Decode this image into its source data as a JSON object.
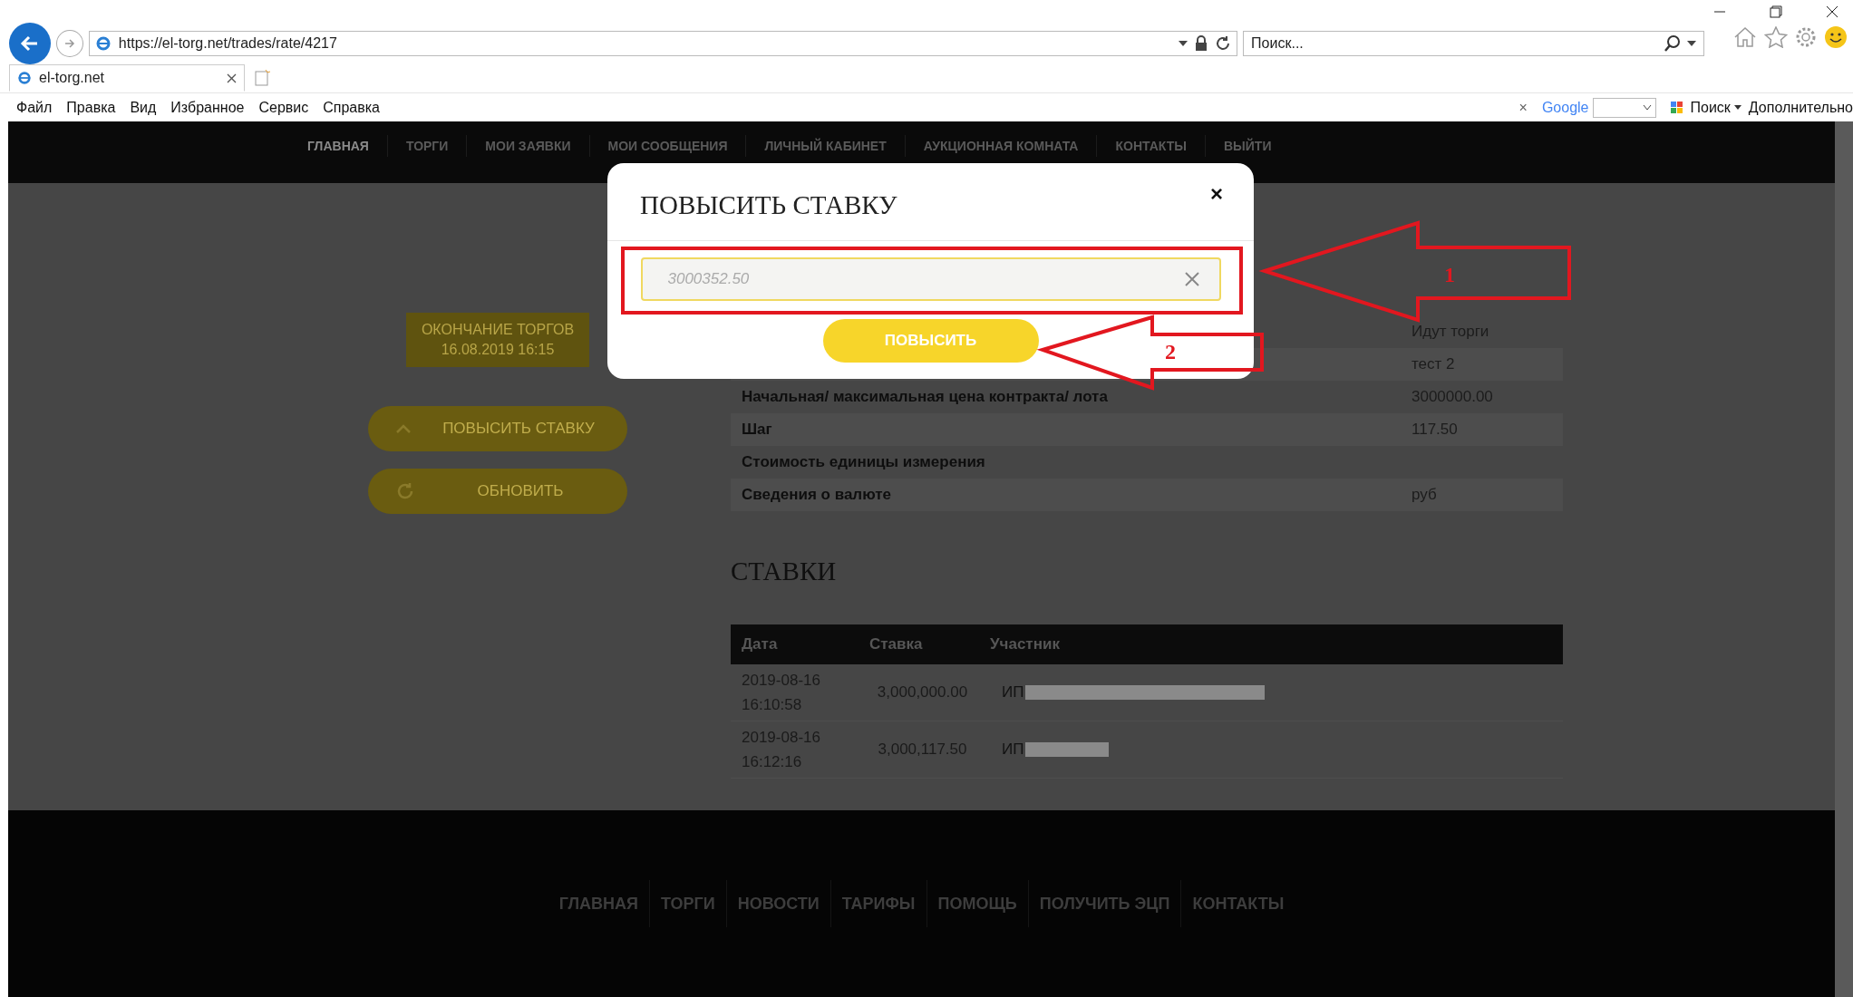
{
  "browser": {
    "url": "https://el-torg.net/trades/rate/4217",
    "search_placeholder": "Поиск...",
    "tabs": [
      {
        "title": "el-torg.net",
        "selected": true
      }
    ],
    "menu": [
      "Файл",
      "Правка",
      "Вид",
      "Избранное",
      "Сервис",
      "Справка"
    ],
    "toolbar": {
      "close": "×",
      "google": "Google",
      "search": "Поиск",
      "more": "Дополнительно"
    }
  },
  "nav": [
    {
      "label": "ГЛАВНАЯ",
      "selected": true
    },
    {
      "label": "ТОРГИ",
      "selected": false
    },
    {
      "label": "МОИ ЗАЯВКИ",
      "selected": false
    },
    {
      "label": "МОИ СООБЩЕНИЯ",
      "selected": false
    },
    {
      "label": "ЛИЧНЫЙ КАБИНЕТ",
      "selected": false
    },
    {
      "label": "АУКЦИОННАЯ КОМНАТА",
      "selected": false
    },
    {
      "label": "КОНТАКТЫ",
      "selected": false
    },
    {
      "label": "ВЫЙТИ",
      "selected": false
    }
  ],
  "countdown": {
    "title": "ОКОНЧАНИЕ ТОРГОВ",
    "date": "16.08.2019 16:15"
  },
  "actions": [
    {
      "label": "ПОВЫСИТЬ СТАВКУ",
      "kind": "raise"
    },
    {
      "label": "ОБНОВИТЬ",
      "kind": "refresh"
    }
  ],
  "info": [
    {
      "value": "Идут торги"
    },
    {
      "value": "тест 2"
    },
    {
      "label": "Начальная/ максимальная цена контракта/ лота",
      "value": "3000000.00"
    },
    {
      "label": "Шаг",
      "value": "117.50"
    },
    {
      "label": "Стоимость единицы измерения"
    },
    {
      "label": "Сведения о валюте",
      "value": "руб"
    }
  ],
  "bids": {
    "title": "СТАВКИ",
    "columns": [
      "Дата",
      "Ставка",
      "Участник"
    ],
    "rows": [
      {
        "date": "2019-08-16 16:10:58",
        "amount": "3,000,000.00",
        "participant": "ИП"
      },
      {
        "date": "2019-08-16 16:12:16",
        "amount": "3,000,117.50",
        "participant": "ИП"
      }
    ]
  },
  "footer_nav": [
    "ГЛАВНАЯ",
    "ТОРГИ",
    "НОВОСТИ",
    "ТАРИФЫ",
    "ПОМОЩЬ",
    "ПОЛУЧИТЬ ЭЦП",
    "КОНТАКТЫ"
  ],
  "modal": {
    "title": "ПОВЫСИТЬ СТАВКУ",
    "close": "×",
    "placeholder": "3000352.50",
    "submit": "ПОВЫСИТЬ"
  },
  "annotations": [
    {
      "label": "1"
    },
    {
      "label": "2"
    }
  ]
}
